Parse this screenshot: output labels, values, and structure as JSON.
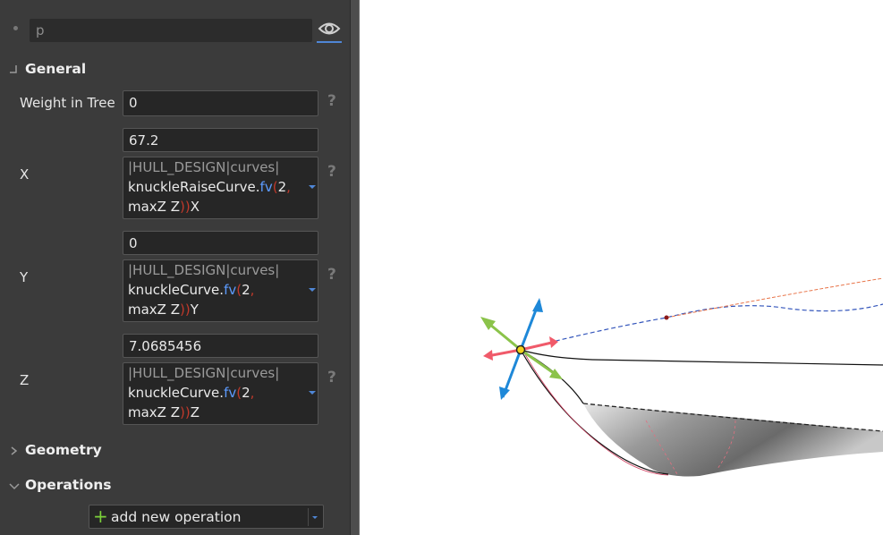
{
  "object_name": "p",
  "sections": {
    "general": "General",
    "geometry": "Geometry",
    "operations": "Operations"
  },
  "weight": {
    "label": "Weight in Tree",
    "value": "0"
  },
  "help": "?",
  "x": {
    "label": "X",
    "value": "67.2",
    "expr": {
      "path": "|HULL_DESIGN|curves|",
      "curve": "knuckleRaiseCurve.",
      "fn": "fv",
      "arg": "2",
      "line3": "maxZ Z",
      "axis": "X"
    }
  },
  "y": {
    "label": "Y",
    "value": "0",
    "expr": {
      "path": "|HULL_DESIGN|curves|",
      "curve": "knuckleCurve.",
      "fn": "fv",
      "arg": "2",
      "line3": "maxZ Z",
      "axis": "Y"
    }
  },
  "z": {
    "label": "Z",
    "value": "7.0685456",
    "expr": {
      "path": "|HULL_DESIGN|curves|",
      "curve": "knuckleCurve.",
      "fn": "fv",
      "arg": "2",
      "line3": "maxZ Z",
      "axis": "Z"
    }
  },
  "add_operation": {
    "plus": "+",
    "label": "add new operation"
  },
  "colors": {
    "panel": "#3b3b3b",
    "field": "#262626",
    "accent": "#4f86d6",
    "gizmo_x": "#f05a6a",
    "gizmo_y": "#8bc34a",
    "gizmo_z": "#1e88d8",
    "curve_orange": "#e8754a",
    "curve_blue": "#3355bb"
  },
  "icons": {
    "visibility": "eye-icon",
    "expanded": "chevron-down-icon",
    "collapsed": "chevron-right-icon",
    "dropdown": "caret-down-icon",
    "add": "plus-icon"
  }
}
